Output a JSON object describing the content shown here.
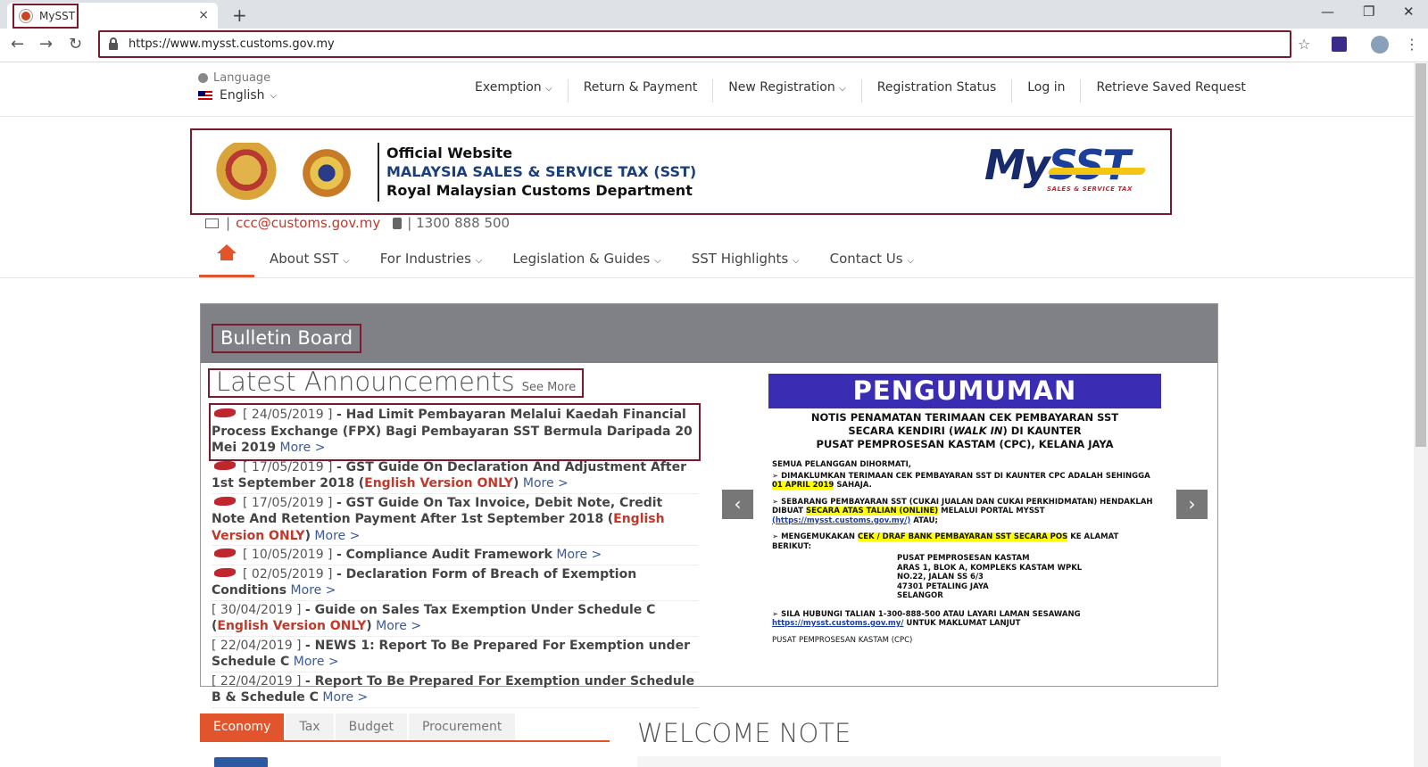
{
  "browser": {
    "tab_title": "MySST",
    "tab_close": "×",
    "new_tab": "+",
    "url": "https://www.mysst.customs.gov.my",
    "back": "←",
    "forward": "→",
    "reload": "↻",
    "star": "☆",
    "menu": "⋮",
    "minimize": "—",
    "restore": "❐",
    "close": "✕"
  },
  "topnav": {
    "language_label": "Language",
    "language_value": "English",
    "items": [
      {
        "label": "Exemption",
        "dropdown": true
      },
      {
        "label": "Return & Payment",
        "dropdown": false
      },
      {
        "label": "New Registration",
        "dropdown": true
      },
      {
        "label": "Registration Status",
        "dropdown": false
      },
      {
        "label": "Log in",
        "dropdown": false
      },
      {
        "label": "Retrieve Saved Request",
        "dropdown": false
      }
    ]
  },
  "banner": {
    "line1": "Official Website",
    "line2": "MALAYSIA SALES & SERVICE TAX (SST)",
    "line3": "Royal Malaysian Customs Department",
    "logo_my": "My",
    "logo_sst": "SST",
    "logo_sub": "SALES & SERVICE TAX"
  },
  "contact": {
    "email": "ccc@customs.gov.my",
    "phone": "1300 888 500"
  },
  "mainnav": {
    "items": [
      "About SST",
      "For Industries",
      "Legislation & Guides",
      "SST Highlights",
      "Contact Us"
    ]
  },
  "bulletin": {
    "title": "Bulletin Board",
    "announcements_title": "Latest Announcements",
    "see_more": "See More",
    "items": [
      {
        "new": true,
        "date": "[ 24/05/2019 ]",
        "text": "- Had Limit Pembayaran Melalui Kaedah Financial Process Exchange (FPX) Bagi Pembayaran SST Bermula Daripada 20 Mei 2019",
        "note": "",
        "more": "More >"
      },
      {
        "new": true,
        "date": "[ 17/05/2019 ]",
        "text": "- GST Guide On Declaration And Adjustment After 1st September 2018",
        "note": "English Version ONLY",
        "more": "More >"
      },
      {
        "new": true,
        "date": "[ 17/05/2019 ]",
        "text": "- GST Guide On Tax Invoice, Debit Note, Credit Note And Retention Payment After 1st September 2018",
        "note": "English Version ONLY",
        "more": "More >"
      },
      {
        "new": true,
        "date": "[ 10/05/2019 ]",
        "text": "- Compliance Audit Framework",
        "note": "",
        "more": "More >"
      },
      {
        "new": true,
        "date": "[ 02/05/2019 ]",
        "text": "- Declaration Form of Breach of Exemption Conditions",
        "note": "",
        "more": "More >"
      },
      {
        "new": false,
        "date": "[ 30/04/2019 ]",
        "text": "- Guide on Sales Tax Exemption Under Schedule C",
        "note": "English Version ONLY",
        "more": "More >"
      },
      {
        "new": false,
        "date": "[ 22/04/2019 ]",
        "text": "- NEWS 1: Report To Be Prepared For Exemption under Schedule C",
        "note": "",
        "more": "More >"
      },
      {
        "new": false,
        "date": "[ 22/04/2019 ]",
        "text": "- Report To Be Prepared For Exemption under Schedule B & Schedule C",
        "note": "",
        "more": "More >"
      }
    ],
    "slider_prev": "‹",
    "slider_next": "›"
  },
  "poster": {
    "title": "PENGUMUMAN",
    "sub1": "NOTIS PENAMATAN TERIMAAN CEK PEMBAYARAN SST",
    "sub2a": "SECARA KENDIRI (",
    "sub2b": "WALK IN",
    "sub2c": ") DI KAUNTER",
    "sub3": "PUSAT PEMPROSESAN KASTAM (CPC), KELANA JAYA",
    "greeting": "SEMUA PELANGGAN DIHORMATI,",
    "p1": "➢ DIMAKLUMKAN TERIMAAN CEK PEMBAYARAN SST DI KAUNTER CPC ADALAH SEHINGGA",
    "p1_date": "01 APRIL 2019",
    "p1_end": "SAHAJA.",
    "p2a": "➢ SEBARANG PEMBAYARAN SST (CUKAI JUALAN DAN CUKAI PERKHIDMATAN) HENDAKLAH DIBUAT",
    "p2_hl": "SECARA ATAS TALIAN (ONLINE)",
    "p2b": "MELALUI PORTAL MYSST",
    "p2_link": "(https://mysst.customs.gov.my/)",
    "p2_end": "ATAU;",
    "p3a": "➢ MENGEMUKAKAN",
    "p3_hl": "CEK / DRAF BANK PEMBAYARAN SST SECARA POS",
    "p3b": "KE ALAMAT BERIKUT:",
    "addr1": "PUSAT PEMPROSESAN KASTAM",
    "addr2": "ARAS 1, BLOK A, KOMPLEKS KASTAM WPKL",
    "addr3": "NO.22, JALAN SS 6/3",
    "addr4": "47301 PETALING JAYA",
    "addr5": "SELANGOR",
    "p4a": "➢ SILA HUBUNGI TALIAN 1-300-888-500 ATAU LAYARI LAMAN SESAWANG",
    "p4_link": "https://mysst.customs.gov.my/",
    "p4b": "UNTUK MAKLUMAT LANJUT",
    "footer": "PUSAT PEMPROSESAN KASTAM (CPC)"
  },
  "bottom": {
    "tabs": [
      "Economy",
      "Tax",
      "Budget",
      "Procurement"
    ],
    "active_tab": "Economy",
    "welcome": "WELCOME NOTE"
  },
  "colors": {
    "accent": "#e2542c",
    "highlight_border": "#7b1a2c",
    "bulletin_header": "#7f8186",
    "poster_bar": "#3b2db3"
  }
}
